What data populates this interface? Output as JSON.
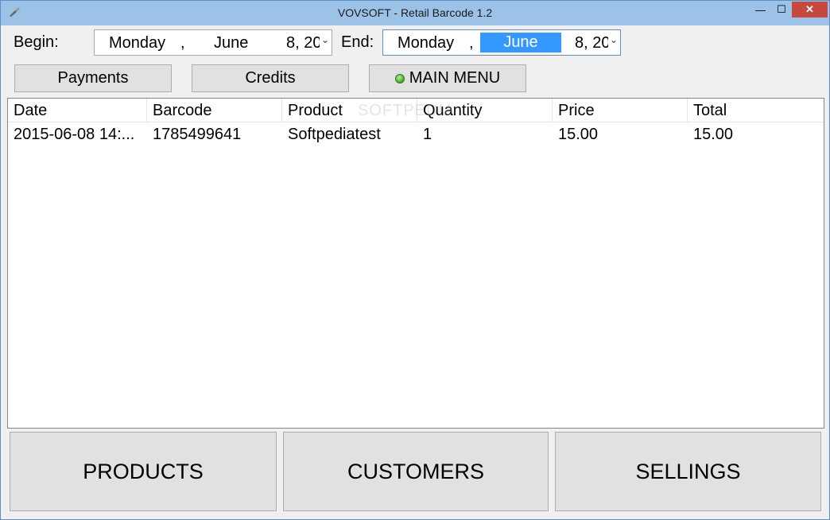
{
  "window": {
    "title": "VOVSOFT - Retail Barcode 1.2",
    "minimize_glyph": "—",
    "maximize_glyph": "☐",
    "close_glyph": "✕"
  },
  "filters": {
    "begin_label": "Begin:",
    "end_label": "End:",
    "begin": {
      "weekday": "Monday",
      "comma": ",",
      "month": "June",
      "day_year": "8, 20"
    },
    "end": {
      "weekday": "Monday",
      "comma": ",",
      "month": "June",
      "day_year": "8, 20"
    },
    "dropdown_glyph": "⌄"
  },
  "buttons": {
    "payments": "Payments",
    "credits": "Credits",
    "main_menu": "MAIN MENU"
  },
  "table": {
    "columns": [
      "Date",
      "Barcode",
      "Product",
      "Quantity",
      "Price",
      "Total"
    ],
    "rows": [
      [
        "2015-06-08 14:...",
        "1785499641",
        "Softpediatest",
        "1",
        "15.00",
        "15.00"
      ]
    ],
    "watermark": "SOFTPEDIA"
  },
  "bottom_nav": {
    "products": "PRODUCTS",
    "customers": "CUSTOMERS",
    "sellings": "SELLINGS"
  }
}
